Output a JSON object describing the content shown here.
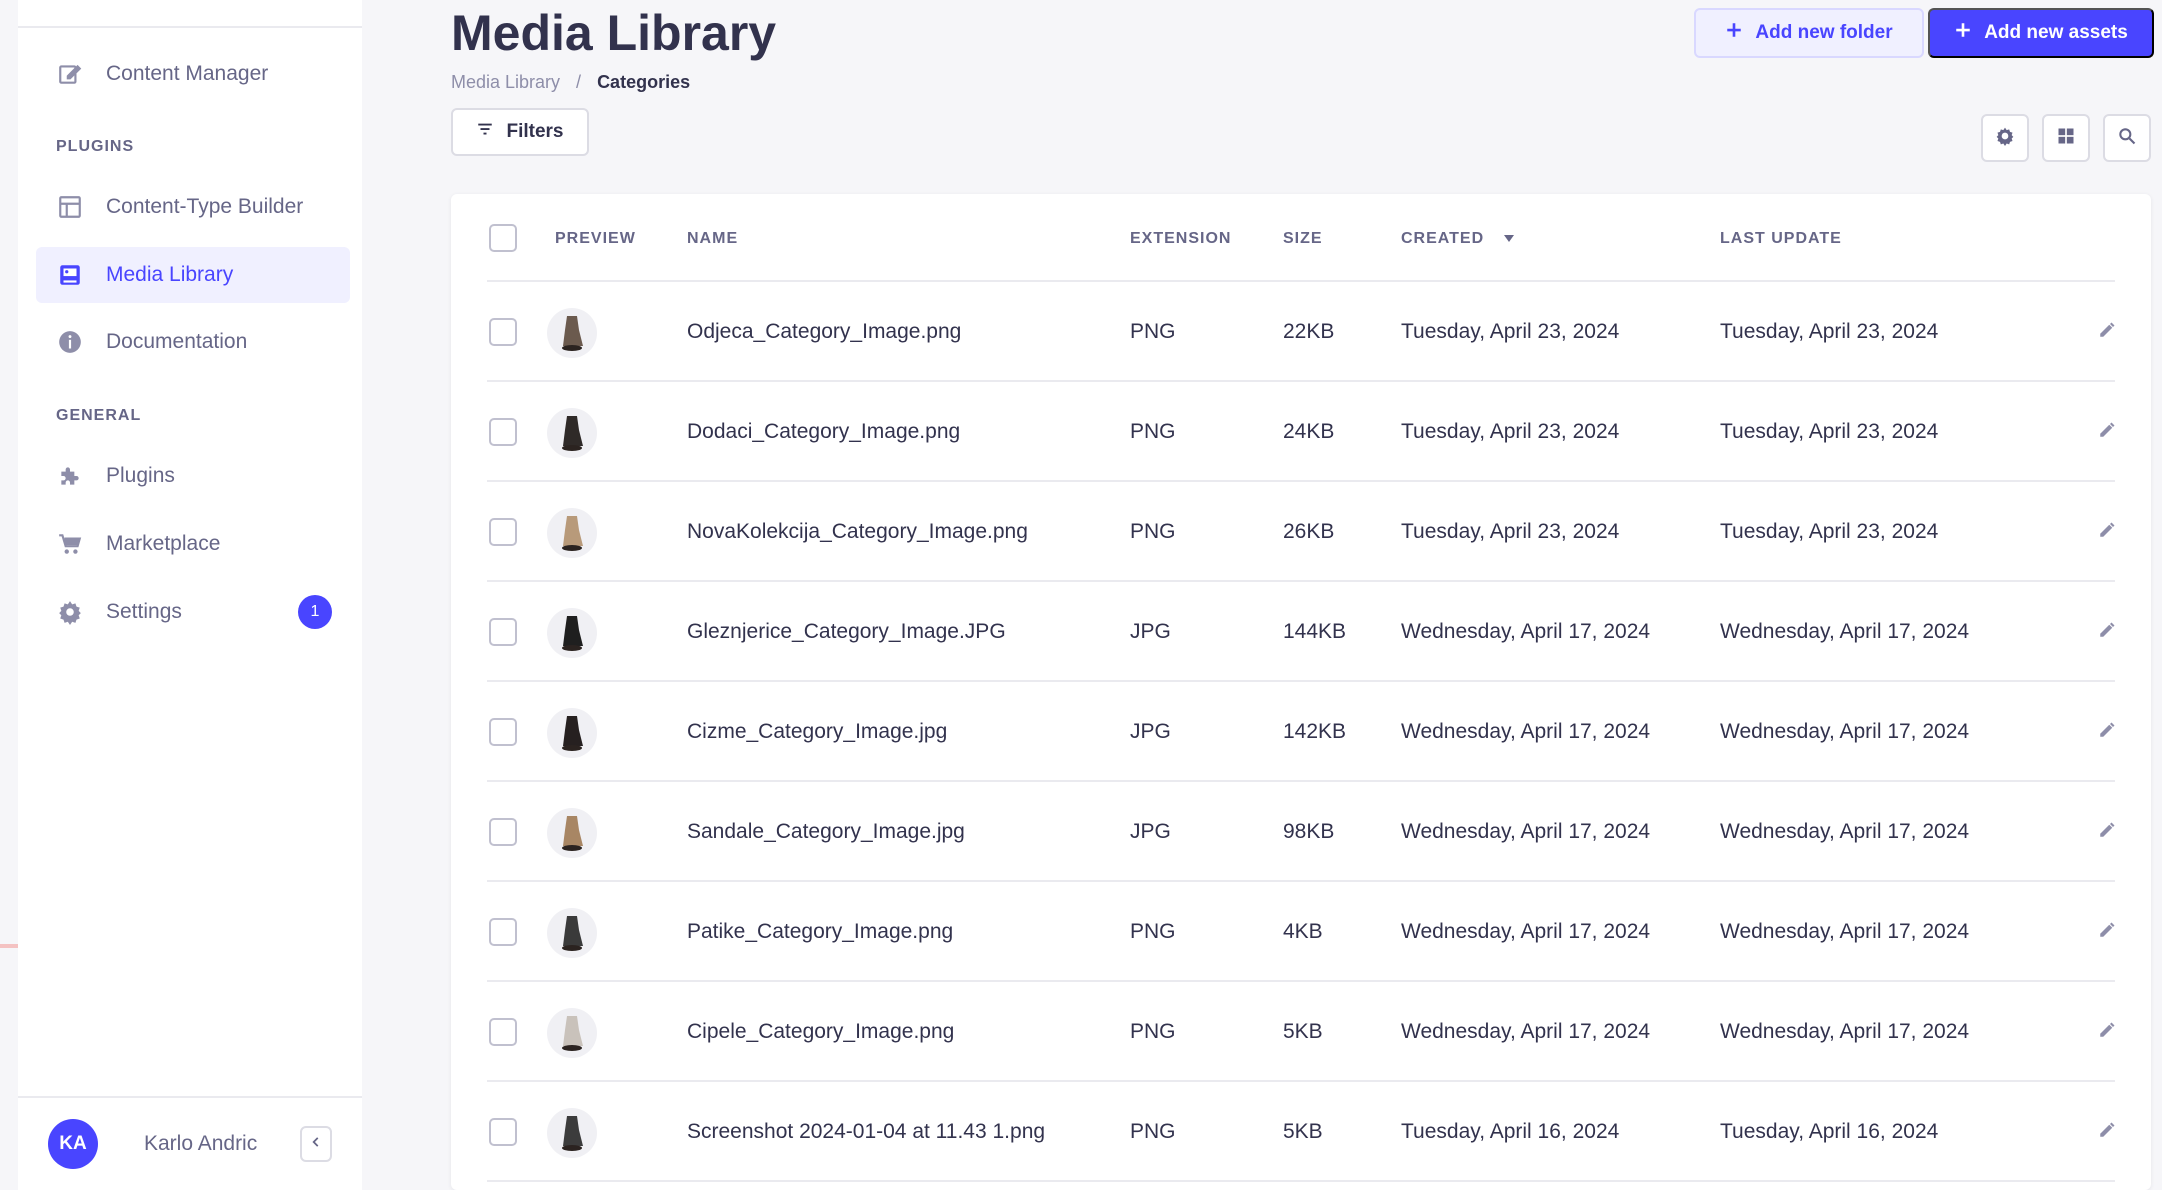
{
  "sidebar": {
    "nav": [
      {
        "label": "Content Manager",
        "icon": "pen-square-icon"
      },
      {
        "label": "Content-Type Builder",
        "icon": "layout-icon"
      },
      {
        "label": "Media Library",
        "icon": "image-icon",
        "active": true
      },
      {
        "label": "Documentation",
        "icon": "info-icon"
      },
      {
        "label": "Plugins",
        "icon": "puzzle-icon"
      },
      {
        "label": "Marketplace",
        "icon": "cart-icon"
      },
      {
        "label": "Settings",
        "icon": "gear-icon",
        "badge": "1"
      }
    ],
    "sections": {
      "plugins": "PLUGINS",
      "general": "GENERAL"
    },
    "user": {
      "initials": "KA",
      "name": "Karlo Andric"
    }
  },
  "header": {
    "title": "Media Library",
    "breadcrumb": {
      "parent": "Media Library",
      "separator": "/",
      "current": "Categories"
    },
    "add_folder_label": "Add new folder",
    "add_assets_label": "Add new assets",
    "filters_label": "Filters"
  },
  "table": {
    "columns": {
      "preview": "PREVIEW",
      "name": "NAME",
      "extension": "EXTENSION",
      "size": "SIZE",
      "created": "CREATED",
      "last_update": "LAST UPDATE"
    },
    "rows": [
      {
        "name": "Odjeca_Category_Image.png",
        "ext": "PNG",
        "size": "22KB",
        "created": "Tuesday, April 23, 2024",
        "updated": "Tuesday, April 23, 2024"
      },
      {
        "name": "Dodaci_Category_Image.png",
        "ext": "PNG",
        "size": "24KB",
        "created": "Tuesday, April 23, 2024",
        "updated": "Tuesday, April 23, 2024"
      },
      {
        "name": "NovaKolekcija_Category_Image.png",
        "ext": "PNG",
        "size": "26KB",
        "created": "Tuesday, April 23, 2024",
        "updated": "Tuesday, April 23, 2024"
      },
      {
        "name": "Gleznjerice_Category_Image.JPG",
        "ext": "JPG",
        "size": "144KB",
        "created": "Wednesday, April 17, 2024",
        "updated": "Wednesday, April 17, 2024"
      },
      {
        "name": "Cizme_Category_Image.jpg",
        "ext": "JPG",
        "size": "142KB",
        "created": "Wednesday, April 17, 2024",
        "updated": "Wednesday, April 17, 2024"
      },
      {
        "name": "Sandale_Category_Image.jpg",
        "ext": "JPG",
        "size": "98KB",
        "created": "Wednesday, April 17, 2024",
        "updated": "Wednesday, April 17, 2024"
      },
      {
        "name": "Patike_Category_Image.png",
        "ext": "PNG",
        "size": "4KB",
        "created": "Wednesday, April 17, 2024",
        "updated": "Wednesday, April 17, 2024"
      },
      {
        "name": "Cipele_Category_Image.png",
        "ext": "PNG",
        "size": "5KB",
        "created": "Wednesday, April 17, 2024",
        "updated": "Wednesday, April 17, 2024"
      },
      {
        "name": "Screenshot 2024-01-04 at 11.43 1.png",
        "ext": "PNG",
        "size": "5KB",
        "created": "Tuesday, April 16, 2024",
        "updated": "Tuesday, April 16, 2024"
      }
    ]
  },
  "colors": {
    "accent": "#4945ff",
    "accent_light": "#f0f0ff",
    "text": "#32324d",
    "muted": "#666687"
  }
}
